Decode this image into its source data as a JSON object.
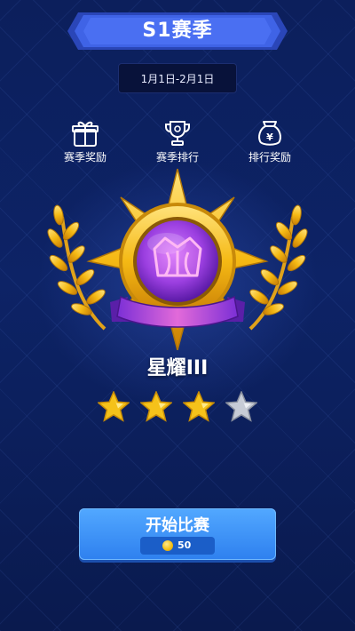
{
  "header": {
    "title": "S1赛季"
  },
  "season": {
    "date_range": "1月1日-2月1日"
  },
  "menu": [
    {
      "label": "赛季奖励",
      "icon": "gift-icon"
    },
    {
      "label": "赛季排行",
      "icon": "trophy-icon"
    },
    {
      "label": "排行奖励",
      "icon": "money-bag-icon"
    }
  ],
  "rank": {
    "name": "星耀III",
    "stars_earned": 3,
    "stars_total": 4,
    "badge_icon": "crown-icon"
  },
  "money_bag_symbol": "¥",
  "start": {
    "label": "开始比赛",
    "cost": "50",
    "currency_icon": "coin-icon"
  },
  "colors": {
    "background": "#0c1f5c",
    "banner": "#3f63e6",
    "gold": "#f5c21a",
    "badge_purple": "#a44be0",
    "button_blue": "#3a8ff5",
    "star_silver": "#c7ccd6"
  }
}
